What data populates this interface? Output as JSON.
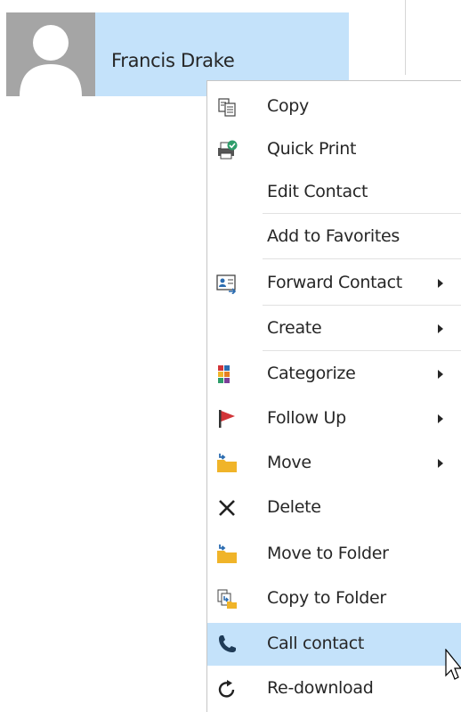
{
  "contact": {
    "name": "Francis Drake"
  },
  "menu": {
    "items": [
      {
        "label": "Copy",
        "icon": "copy-icon"
      },
      {
        "label": "Quick Print",
        "icon": "quick-print-icon"
      },
      {
        "label": "Edit Contact",
        "icon": null
      },
      {
        "label": "Add to Favorites",
        "icon": null
      },
      {
        "label": "Forward Contact",
        "icon": "forward-contact-icon",
        "submenu": true
      },
      {
        "label": "Create",
        "icon": null,
        "submenu": true
      },
      {
        "label": "Categorize",
        "icon": "categorize-icon",
        "submenu": true
      },
      {
        "label": "Follow Up",
        "icon": "flag-icon",
        "submenu": true
      },
      {
        "label": "Move",
        "icon": "move-folder-icon",
        "submenu": true
      },
      {
        "label": "Delete",
        "icon": "delete-icon"
      },
      {
        "label": "Move to Folder",
        "icon": "move-folder-icon"
      },
      {
        "label": "Copy to Folder",
        "icon": "copy-folder-icon"
      },
      {
        "label": "Call contact",
        "icon": "phone-icon",
        "highlighted": true
      },
      {
        "label": "Re-download",
        "icon": "refresh-icon"
      }
    ]
  },
  "colors": {
    "selection": "#c4e2fa",
    "flag": "#d13438",
    "folder": "#f0b429"
  }
}
